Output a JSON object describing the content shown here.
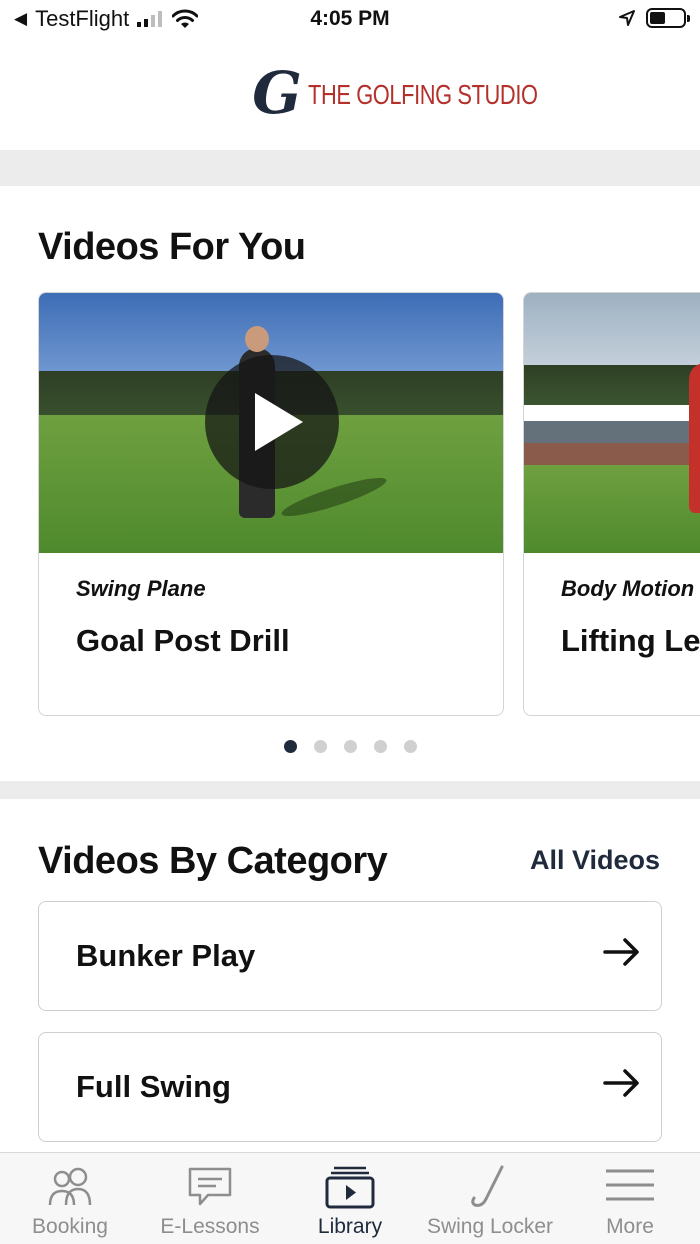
{
  "status_bar": {
    "back_label": "TestFlight",
    "time": "4:05 PM"
  },
  "header": {
    "logo_mark": "G",
    "brand_name": "THE GOLFING STUDIO"
  },
  "videos_for_you": {
    "title": "Videos For You",
    "cards": [
      {
        "category": "Swing Plane",
        "title": "Goal Post Drill"
      },
      {
        "category": "Body Motion",
        "title": "Lifting Leg Shift Drill"
      }
    ],
    "page_indicator": {
      "current": 1,
      "total": 5
    }
  },
  "videos_by_category": {
    "title": "Videos By Category",
    "all_videos_label": "All Videos",
    "categories": [
      {
        "label": "Bunker Play"
      },
      {
        "label": "Full Swing"
      }
    ]
  },
  "tab_bar": {
    "active_tab": "Library",
    "tabs": [
      {
        "label": "Booking",
        "icon": "people-icon"
      },
      {
        "label": "E-Lessons",
        "icon": "chat-bubble-icon"
      },
      {
        "label": "Library",
        "icon": "video-library-icon"
      },
      {
        "label": "Swing Locker",
        "icon": "golf-club-icon"
      },
      {
        "label": "More",
        "icon": "menu-icon"
      }
    ]
  },
  "colors": {
    "brand_navy": "#1f2a3d",
    "brand_red": "#b3302b",
    "band_gray": "#ececec"
  }
}
